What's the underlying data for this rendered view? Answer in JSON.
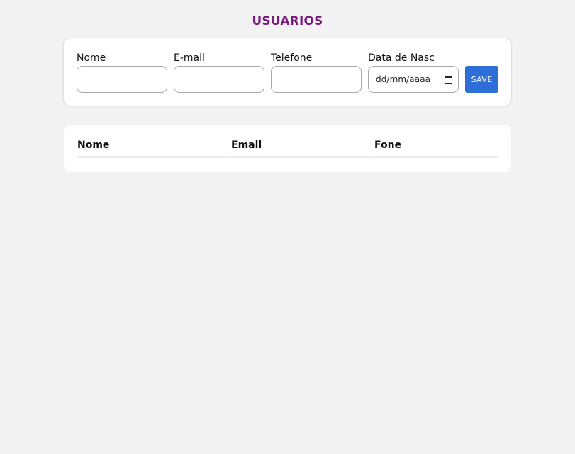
{
  "page": {
    "title": "USUARIOS",
    "title_color": "#7a1a7e",
    "background_color": "#f2f2f2"
  },
  "form": {
    "fields": [
      {
        "label": "Nome",
        "value": "",
        "placeholder": ""
      },
      {
        "label": "E-mail",
        "value": "",
        "placeholder": ""
      },
      {
        "label": "Telefone",
        "value": "",
        "placeholder": ""
      },
      {
        "label": "Data de Nasc",
        "value": "",
        "placeholder": "dd/mm/aaaa"
      }
    ],
    "save_label": "SAVE",
    "save_color": "#2d6fd6",
    "date_icon": "calendar-icon"
  },
  "table": {
    "columns": [
      "Nome",
      "Email",
      "Fone"
    ],
    "rows": []
  }
}
